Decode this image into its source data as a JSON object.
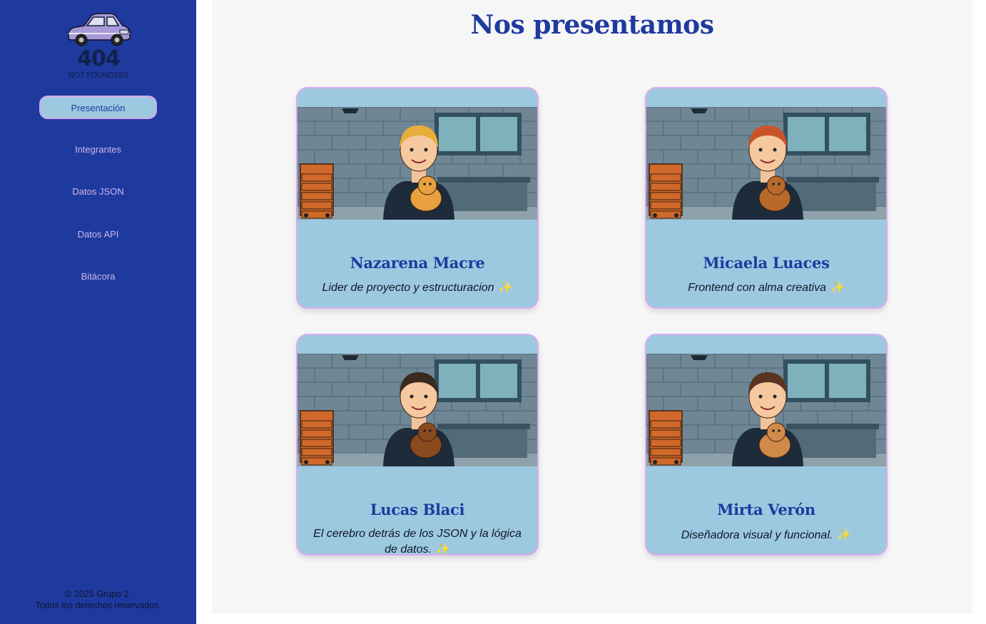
{
  "logo": {
    "number": "404",
    "text": "NOT FOUNDERS"
  },
  "nav": [
    {
      "label": "Presentación",
      "active": true
    },
    {
      "label": "Integrantes"
    },
    {
      "label": "Datos JSON"
    },
    {
      "label": "Datos API"
    },
    {
      "label": "Bitácora"
    }
  ],
  "footer": {
    "line1": "© 2025 Grupo 2.",
    "line2": "Todos los derechos reservados."
  },
  "main": {
    "title": "Nos presentamos",
    "members": [
      {
        "name": "Nazarena Macre",
        "role": "Lider de proyecto y estructuracion",
        "sparkle": "✨",
        "hair": "#e8ae3a",
        "pet": "cat"
      },
      {
        "name": "Micaela Luaces",
        "role": "Frontend con alma creativa",
        "sparkle": "✨",
        "hair": "#c9542a",
        "pet": "dog"
      },
      {
        "name": "Lucas Blaci",
        "role": "El cerebro detrás de los JSON y la lógica de datos.",
        "sparkle": "✨",
        "hair": "#3b2a1e",
        "pet": "bulldog"
      },
      {
        "name": "Mirta Verón",
        "role": "Diseñadora visual y funcional.",
        "sparkle": "✨",
        "hair": "#5a3420",
        "pet": "hamster"
      }
    ]
  },
  "colors": {
    "sidebar": "#1f3a9e",
    "card": "#9dc9e0",
    "title": "#1f3a9e",
    "active_border": "#d9a8ee"
  }
}
